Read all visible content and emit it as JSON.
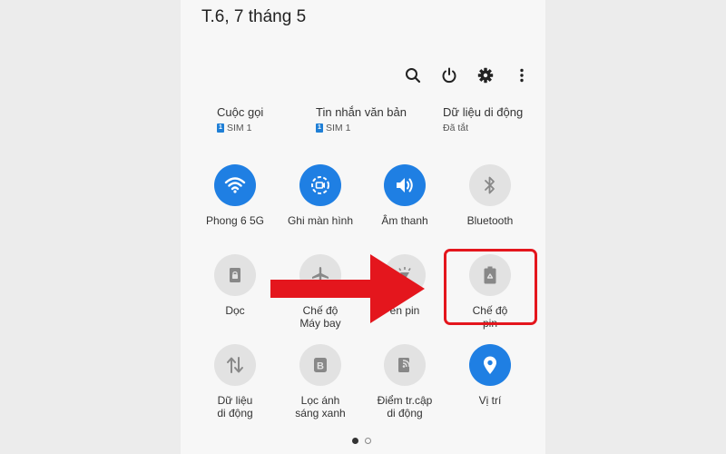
{
  "header": {
    "date": "T.6, 7 tháng 5"
  },
  "top_icons": [
    "search-icon",
    "power-icon",
    "gear-icon",
    "more-vert-icon"
  ],
  "status": [
    {
      "title": "Cuộc gọi",
      "sub": "SIM 1",
      "sim_badge": "1"
    },
    {
      "title": "Tin nhắn văn bản",
      "sub": "SIM 1",
      "sim_badge": "1"
    },
    {
      "title": "Dữ liệu di động",
      "sub": "Đã tắt"
    }
  ],
  "tiles": [
    {
      "label": "Phong 6 5G",
      "icon": "wifi-icon",
      "state": "on"
    },
    {
      "label": "Ghi màn hình",
      "icon": "screen-record-icon",
      "state": "on"
    },
    {
      "label": "Âm thanh",
      "icon": "sound-icon",
      "state": "on"
    },
    {
      "label": "Bluetooth",
      "icon": "bluetooth-icon",
      "state": "off"
    },
    {
      "label": "Dọc",
      "icon": "portrait-lock-icon",
      "state": "off"
    },
    {
      "label": "Chế độ\nMáy bay",
      "icon": "airplane-icon",
      "state": "off"
    },
    {
      "label": "en pin",
      "icon": "flashlight-icon",
      "state": "off"
    },
    {
      "label": "Chế độ\npin",
      "icon": "battery-saver-icon",
      "state": "off"
    },
    {
      "label": "Dữ liệu\ndi động",
      "icon": "mobile-data-icon",
      "state": "off"
    },
    {
      "label": "Lọc ánh\nsáng xanh",
      "icon": "blue-light-icon",
      "state": "off"
    },
    {
      "label": "Điểm tr.cập\ndi động",
      "icon": "hotspot-icon",
      "state": "off"
    },
    {
      "label": "Vị trí",
      "icon": "location-icon",
      "state": "on"
    }
  ],
  "page_indicator": {
    "pages": 2,
    "current": 1
  },
  "colors": {
    "accent": "#1f7fe3",
    "arrow": "#e4161d",
    "tile_off": "#e2e2e2"
  }
}
